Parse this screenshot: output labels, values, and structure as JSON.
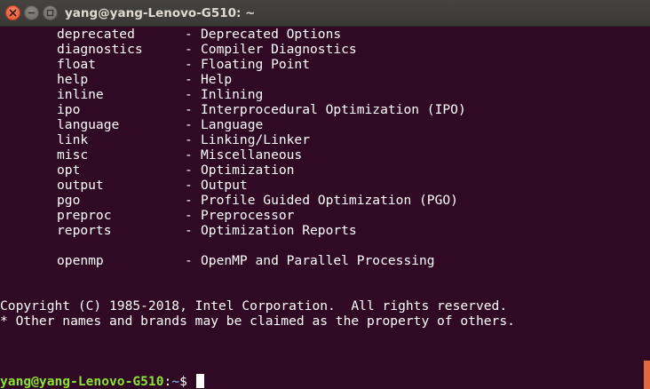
{
  "window": {
    "title": "yang@yang-Lenovo-G510: ~"
  },
  "terminal": {
    "options": [
      {
        "name": "deprecated",
        "dash": "-",
        "desc": "Deprecated Options"
      },
      {
        "name": "diagnostics",
        "dash": "-",
        "desc": "Compiler Diagnostics"
      },
      {
        "name": "float",
        "dash": "-",
        "desc": "Floating Point"
      },
      {
        "name": "help",
        "dash": "-",
        "desc": "Help"
      },
      {
        "name": "inline",
        "dash": "-",
        "desc": "Inlining"
      },
      {
        "name": "ipo",
        "dash": "-",
        "desc": "Interprocedural Optimization (IPO)"
      },
      {
        "name": "language",
        "dash": "-",
        "desc": "Language"
      },
      {
        "name": "link",
        "dash": "-",
        "desc": "Linking/Linker"
      },
      {
        "name": "misc",
        "dash": "-",
        "desc": "Miscellaneous"
      },
      {
        "name": "opt",
        "dash": "-",
        "desc": "Optimization"
      },
      {
        "name": "output",
        "dash": "-",
        "desc": "Output"
      },
      {
        "name": "pgo",
        "dash": "-",
        "desc": "Profile Guided Optimization (PGO)"
      },
      {
        "name": "preproc",
        "dash": "-",
        "desc": "Preprocessor"
      },
      {
        "name": "reports",
        "dash": "-",
        "desc": "Optimization Reports"
      }
    ],
    "extra_option": {
      "name": "openmp",
      "dash": "-",
      "desc": "OpenMP and Parallel Processing"
    },
    "copyright": "Copyright (C) 1985-2018, Intel Corporation.  All rights reserved.",
    "trademark": "* Other names and brands may be claimed as the property of others.",
    "prompt": {
      "user_host": "yang@yang-Lenovo-G510",
      "separator": ":",
      "path": "~",
      "symbol": "$ "
    }
  },
  "colors": {
    "background": "#300a24",
    "text": "#ffffff",
    "prompt_user": "#8ae234",
    "prompt_path": "#729fcf",
    "close_button": "#e0522c",
    "scrollbar_thumb": "#e06a3e"
  }
}
